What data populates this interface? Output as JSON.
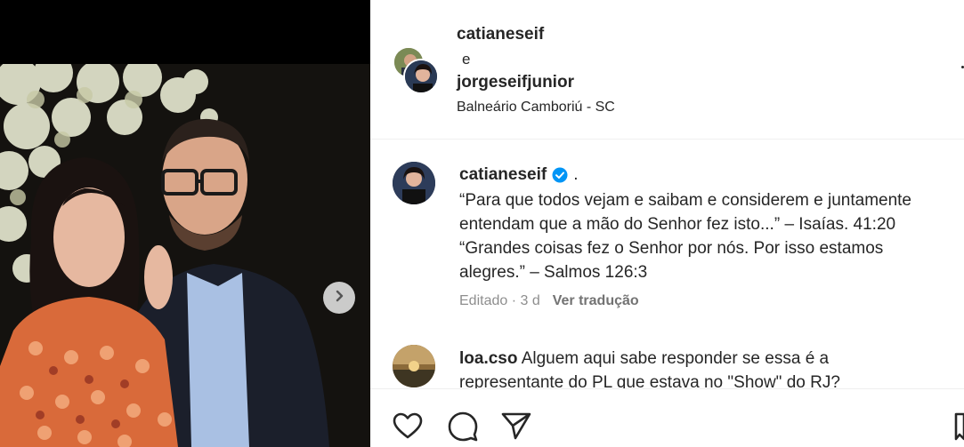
{
  "post": {
    "header": {
      "user1": "catianeseif",
      "connector": "e",
      "user2": "jorgeseifjunior",
      "location": "Balneário Camboriú - SC"
    },
    "caption": {
      "username": "catianeseif",
      "dot": ".",
      "line1": "“Para que todos vejam e saibam e considerem e juntamente",
      "line2": "entendam que a mão do Senhor fez isto...” – Isaías. 41:20",
      "line3": "“Grandes coisas fez o Senhor por nós. Por isso estamos",
      "line4": "alegres.” – Salmos 126:3",
      "edited": "Editado · 3 d",
      "translate": "Ver tradução"
    },
    "comment": {
      "username": "loa.cso",
      "text_line1": " Alguem aqui sabe responder se essa é a",
      "text_line2": "representante do PL que estava no \"Show\" do RJ?"
    },
    "icons": {
      "like": "heart-icon",
      "comment": "comment-icon",
      "share": "send-icon",
      "next": "chevron-right-icon",
      "verified": "verified-badge-icon"
    },
    "colors": {
      "verified": "#0095f6",
      "secondary_text": "#8e8e8e",
      "divider": "#efefef"
    }
  }
}
